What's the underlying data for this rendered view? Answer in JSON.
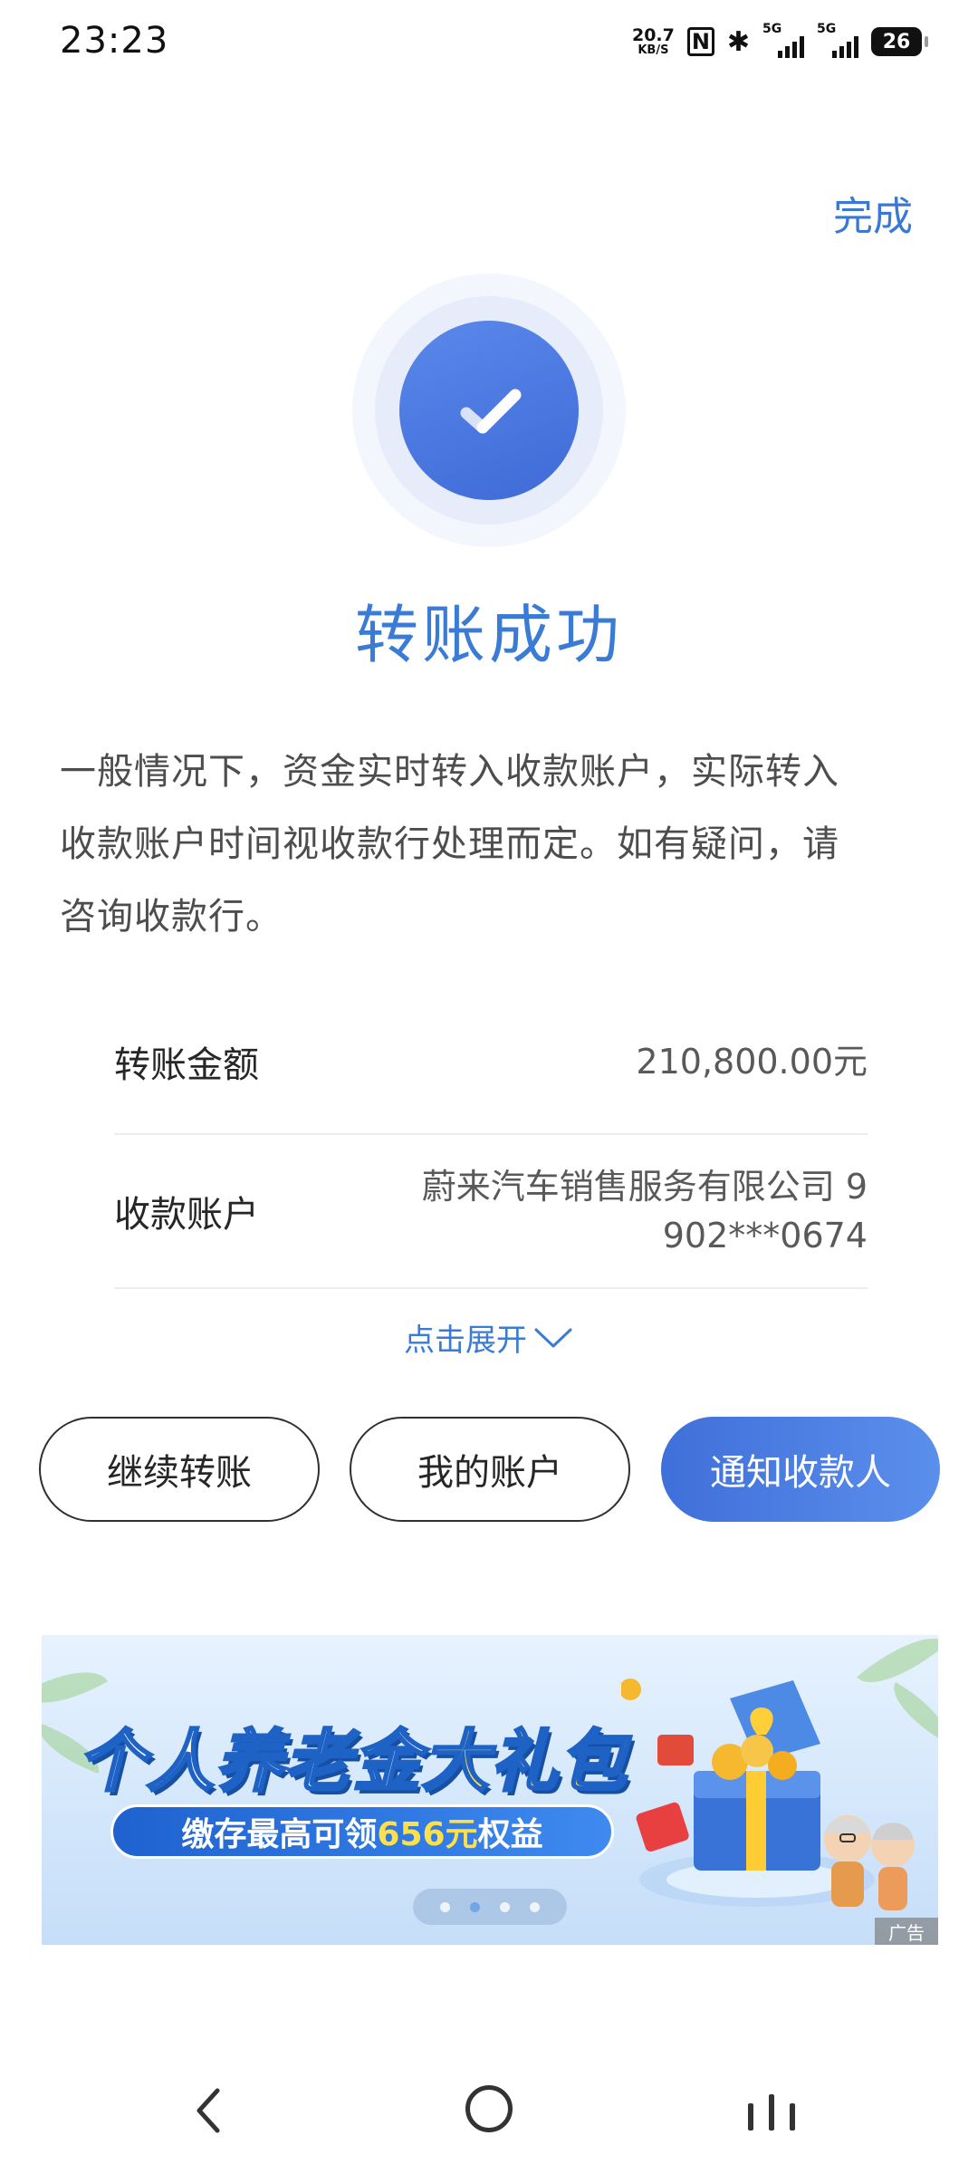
{
  "status_bar": {
    "time": "23:23",
    "net_speed": "20.7",
    "net_unit": "KB/S",
    "nfc": "N",
    "bluetooth": "✱",
    "signal1_label": "5G",
    "signal2_label": "5G",
    "battery": "26"
  },
  "header": {
    "done_label": "完成"
  },
  "result": {
    "icon": "checkmark-icon",
    "title": "转账成功",
    "notice_lines": [
      "一般情况下，资金实时转入收款账户，实际转入",
      "收款账户时间视收款行处理而定。如有疑问，请",
      "咨询收款行。"
    ]
  },
  "details": [
    {
      "label": "转账金额",
      "value_lines": [
        "210,800.00元"
      ]
    },
    {
      "label": "收款账户",
      "value_lines": [
        "蔚来汽车销售服务有限公司 9",
        "902***0674"
      ]
    }
  ],
  "expand": {
    "label": "点击展开",
    "icon": "chevron-down-icon"
  },
  "actions": {
    "continue_label": "继续转账",
    "account_label": "我的账户",
    "notify_label": "通知收款人"
  },
  "ad": {
    "title_part1": "个人养老金",
    "title_part2": "大礼包",
    "sub_part1": "缴存最高可领",
    "sub_part2": "656元",
    "sub_part3": "权益",
    "tag": "广告",
    "page_count": 4,
    "active_page": 2
  },
  "colors": {
    "accent": "#3a7bd5",
    "primary_button": "#4a7fe3"
  }
}
